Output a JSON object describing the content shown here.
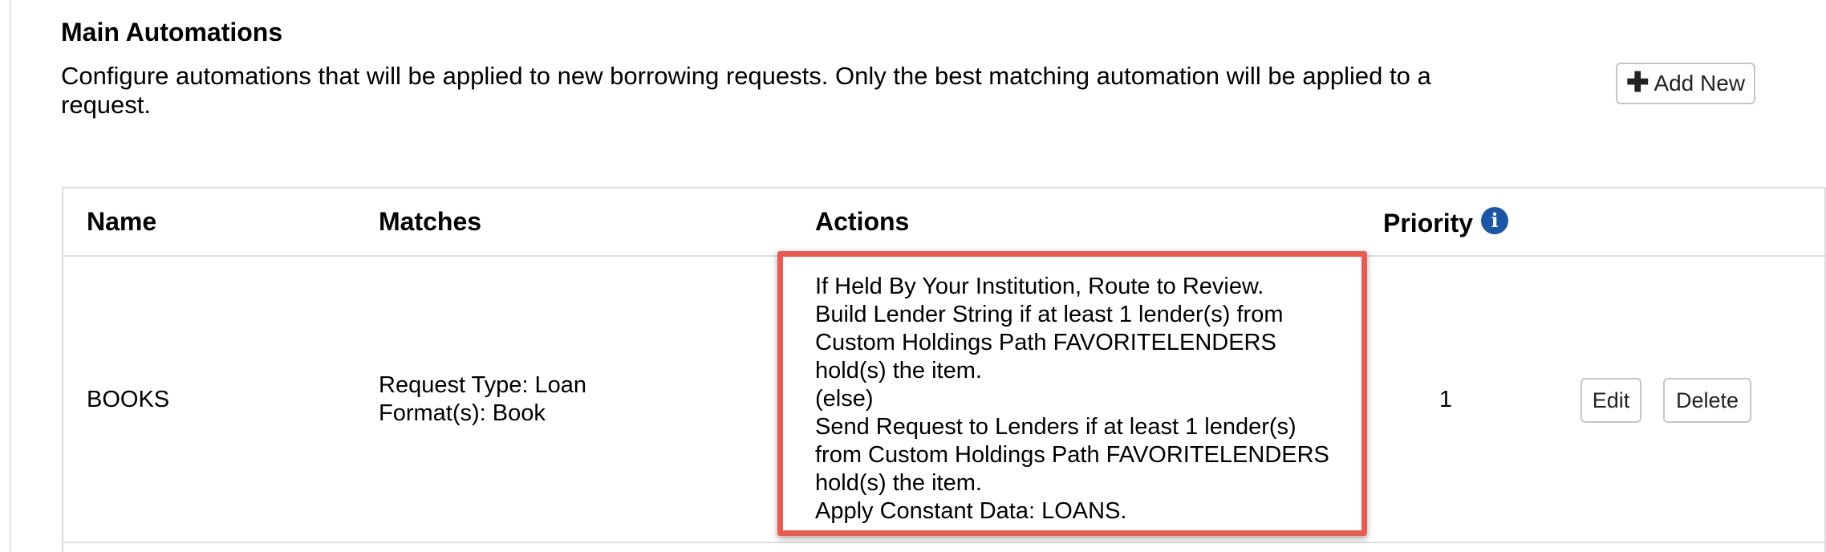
{
  "section": {
    "title": "Main Automations",
    "description": "Configure automations that will be applied to new borrowing requests. Only the best matching automation will be applied to a request.",
    "add_new_label": "Add New",
    "add_new_icon": "plus-icon"
  },
  "table": {
    "headers": {
      "name": "Name",
      "matches": "Matches",
      "actions": "Actions",
      "priority": "Priority",
      "priority_icon": "info-icon"
    },
    "rows": [
      {
        "name": "BOOKS",
        "matches": [
          "Request Type: Loan",
          "Format(s): Book"
        ],
        "actions": [
          "If Held By Your Institution, Route to Review.",
          "Build Lender String if at least 1 lender(s) from",
          "Custom Holdings Path FAVORITELENDERS",
          "hold(s) the item.",
          "(else)",
          "Send Request to Lenders if at least 1 lender(s)",
          "from Custom Holdings Path FAVORITELENDERS",
          "hold(s) the item.",
          "Apply Constant Data: LOANS."
        ],
        "priority": "1",
        "edit_label": "Edit",
        "delete_label": "Delete"
      }
    ]
  },
  "colors": {
    "highlight_border": "#ec5a4f",
    "info_icon": "#1a56a8",
    "divider": "#dddddd"
  }
}
